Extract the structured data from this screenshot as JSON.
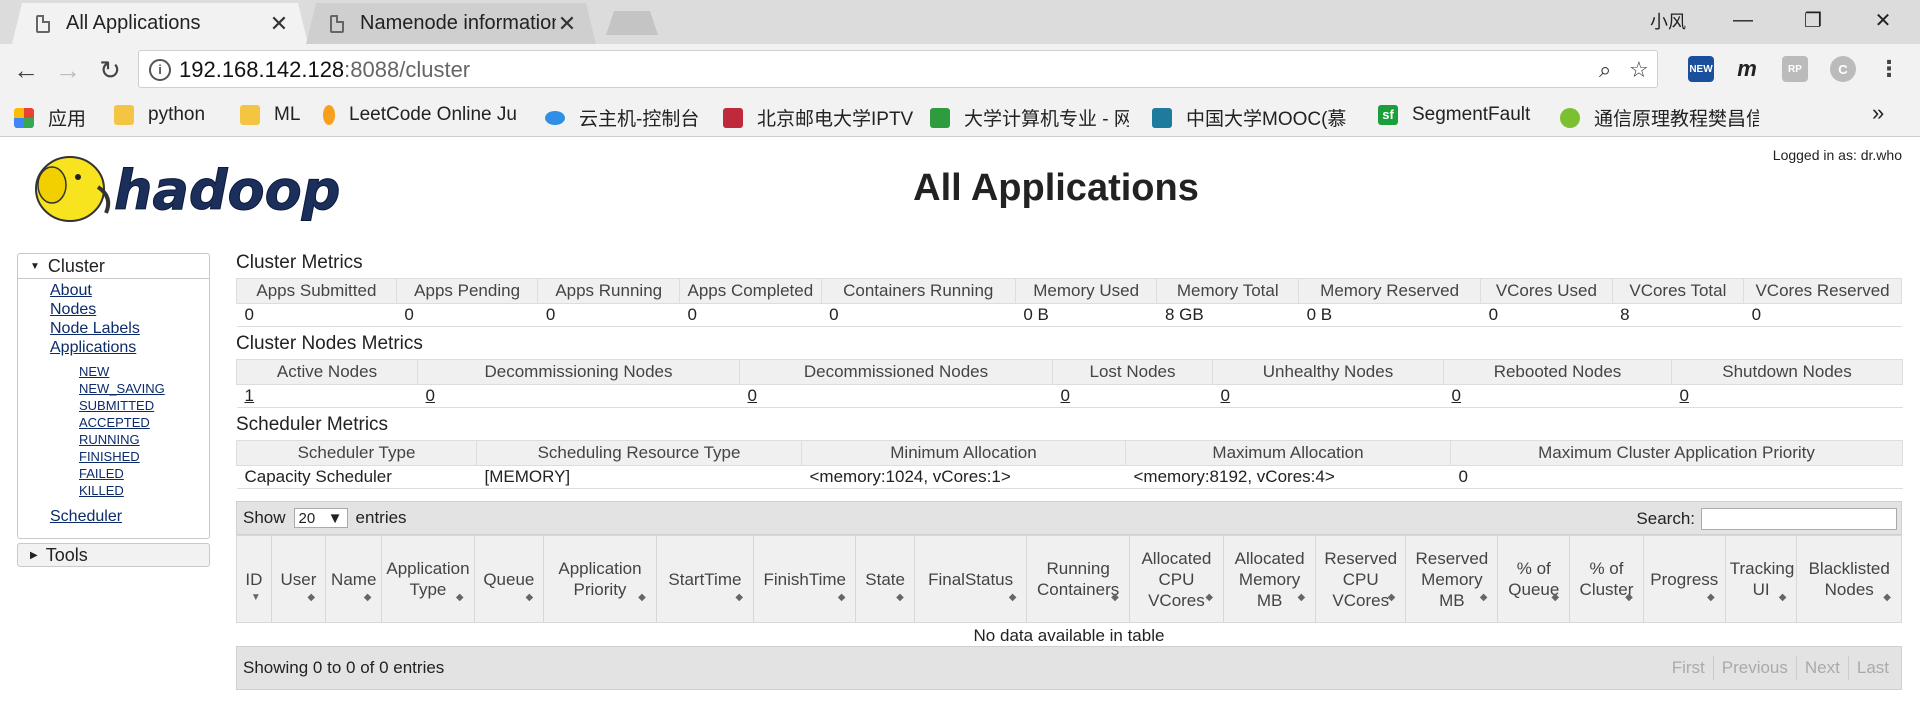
{
  "browser": {
    "tabs": [
      {
        "title": "All Applications",
        "active": true
      },
      {
        "title": "Namenode information",
        "active": false
      }
    ],
    "user_name": "小风",
    "url": {
      "host": "192.168.142.128",
      "rest": ":8088/cluster"
    },
    "window_controls": {
      "minimize": "—",
      "maximize": "❐",
      "close": "✕"
    },
    "bookmarks": [
      {
        "label": "应用",
        "icon": "apps-grid-icon",
        "color": "#e94235"
      },
      {
        "label": "python",
        "icon": "folder-icon",
        "color": "#f4c542"
      },
      {
        "label": "ML",
        "icon": "folder-icon",
        "color": "#f4c542"
      },
      {
        "label": "LeetCode Online Ju",
        "icon": "leetcode-icon",
        "color": "#f89f1b"
      },
      {
        "label": "云主机-控制台",
        "icon": "cloud-icon",
        "color": "#2f8fe5"
      },
      {
        "label": "北京邮电大学IPTV",
        "icon": "butterfly-icon",
        "color": "#c0283b"
      },
      {
        "label": "大学计算机专业 - 网",
        "icon": "book-icon",
        "color": "#2e9b3e"
      },
      {
        "label": "中国大学MOOC(慕",
        "icon": "mooc-icon",
        "color": "#1d7b9e"
      },
      {
        "label": "SegmentFault",
        "icon": "sf-icon",
        "color": "#1a9f3a"
      },
      {
        "label": "通信原理教程樊昌信",
        "icon": "green-circle-icon",
        "color": "#7cc032"
      }
    ],
    "bookmarks_overflow": "»"
  },
  "page": {
    "logo_text": "hadoop",
    "logged_in": "Logged in as: dr.who",
    "title": "All Applications"
  },
  "nav": {
    "cluster_label": "Cluster",
    "links": [
      "About",
      "Nodes",
      "Node Labels",
      "Applications"
    ],
    "app_states": [
      "NEW",
      "NEW_SAVING",
      "SUBMITTED",
      "ACCEPTED",
      "RUNNING",
      "FINISHED",
      "FAILED",
      "KILLED"
    ],
    "scheduler": "Scheduler",
    "tools_label": "Tools"
  },
  "cluster_metrics": {
    "title": "Cluster Metrics",
    "headers": [
      "Apps Submitted",
      "Apps Pending",
      "Apps Running",
      "Apps Completed",
      "Containers Running",
      "Memory Used",
      "Memory Total",
      "Memory Reserved",
      "VCores Used",
      "VCores Total",
      "VCores Reserved"
    ],
    "values": [
      "0",
      "0",
      "0",
      "0",
      "0",
      "0 B",
      "8 GB",
      "0 B",
      "0",
      "8",
      "0"
    ]
  },
  "nodes_metrics": {
    "title": "Cluster Nodes Metrics",
    "headers": [
      "Active Nodes",
      "Decommissioning Nodes",
      "Decommissioned Nodes",
      "Lost Nodes",
      "Unhealthy Nodes",
      "Rebooted Nodes",
      "Shutdown Nodes"
    ],
    "values": [
      "1",
      "0",
      "0",
      "0",
      "0",
      "0",
      "0"
    ]
  },
  "scheduler_metrics": {
    "title": "Scheduler Metrics",
    "headers": [
      "Scheduler Type",
      "Scheduling Resource Type",
      "Minimum Allocation",
      "Maximum Allocation",
      "Maximum Cluster Application Priority"
    ],
    "values": [
      "Capacity Scheduler",
      "[MEMORY]",
      "<memory:1024, vCores:1>",
      "<memory:8192, vCores:4>",
      "0"
    ]
  },
  "apps_table": {
    "show_label": "Show",
    "page_size": "20",
    "entries_label": "entries",
    "search_label": "Search:",
    "columns": [
      "ID",
      "User",
      "Name",
      "Application Type",
      "Queue",
      "Application Priority",
      "StartTime",
      "FinishTime",
      "State",
      "FinalStatus",
      "Running Containers",
      "Allocated CPU VCores",
      "Allocated Memory MB",
      "Reserved CPU VCores",
      "Reserved Memory MB",
      "% of Queue",
      "% of Cluster",
      "Progress",
      "Tracking UI",
      "Blacklisted Nodes"
    ],
    "empty_message": "No data available in table",
    "info": "Showing 0 to 0 of 0 entries",
    "paging": [
      "First",
      "Previous",
      "Next",
      "Last"
    ]
  }
}
